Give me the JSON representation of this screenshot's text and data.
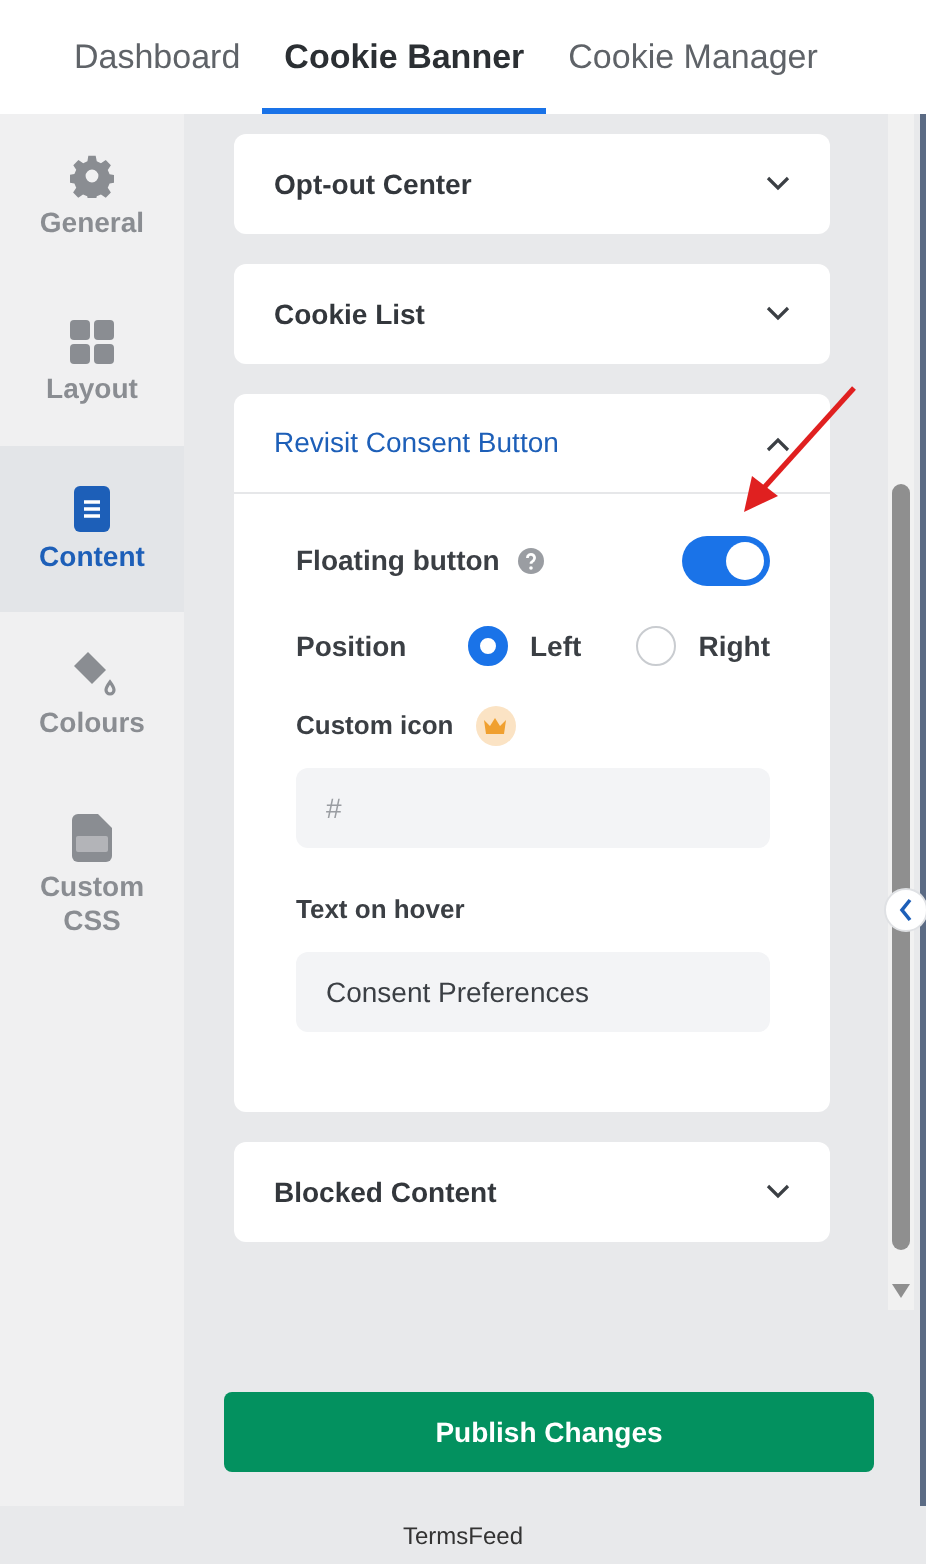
{
  "top_tabs": [
    {
      "label": "Dashboard",
      "selected": false
    },
    {
      "label": "Cookie Banner",
      "selected": true
    },
    {
      "label": "Cookie Manager",
      "selected": false
    }
  ],
  "sidebar": {
    "items": [
      {
        "label": "General",
        "selected": false
      },
      {
        "label": "Layout",
        "selected": false
      },
      {
        "label": "Content",
        "selected": true
      },
      {
        "label": "Colours",
        "selected": false
      },
      {
        "label": "Custom CSS",
        "selected": false
      }
    ]
  },
  "sections": [
    {
      "title": "Opt-out Center",
      "expanded": false
    },
    {
      "title": "Cookie List",
      "expanded": false
    },
    {
      "title": "Revisit Consent Button",
      "expanded": true,
      "fields": [
        {
          "kind": "toggle",
          "label": "Floating button",
          "help": true,
          "on": true
        },
        {
          "kind": "radio",
          "label": "Position",
          "options": [
            {
              "label": "Left",
              "selected": true
            },
            {
              "label": "Right",
              "selected": false
            }
          ]
        },
        {
          "kind": "input",
          "label": "Custom icon",
          "premium": true,
          "placeholder": "#"
        },
        {
          "kind": "input",
          "label": "Text on hover",
          "value": "Consent Preferences"
        }
      ]
    },
    {
      "title": "Blocked Content",
      "expanded": false
    }
  ],
  "publish_button": "Publish Changes",
  "footer": "TermsFeed"
}
